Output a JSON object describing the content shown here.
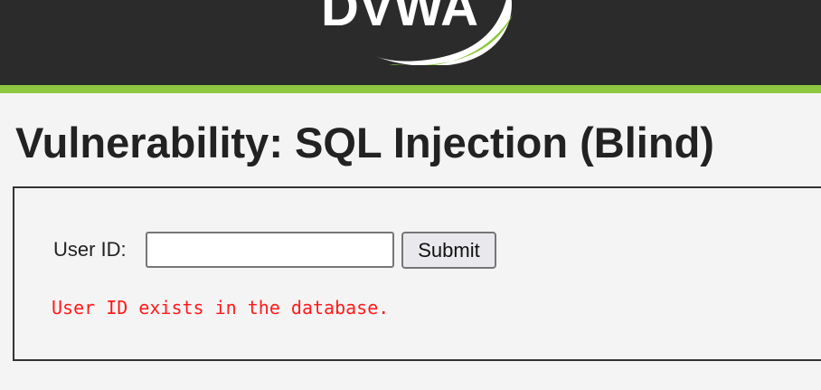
{
  "header": {
    "logo_text": "DVWA",
    "colors": {
      "background": "#2b2b2b",
      "stripe": "#8dc63f"
    }
  },
  "page": {
    "title": "Vulnerability: SQL Injection (Blind)"
  },
  "form": {
    "user_id_label": "User ID:",
    "user_id_value": "",
    "submit_label": "Submit"
  },
  "result": {
    "message": "User ID exists in the database.",
    "color": "#ff1a1a"
  }
}
